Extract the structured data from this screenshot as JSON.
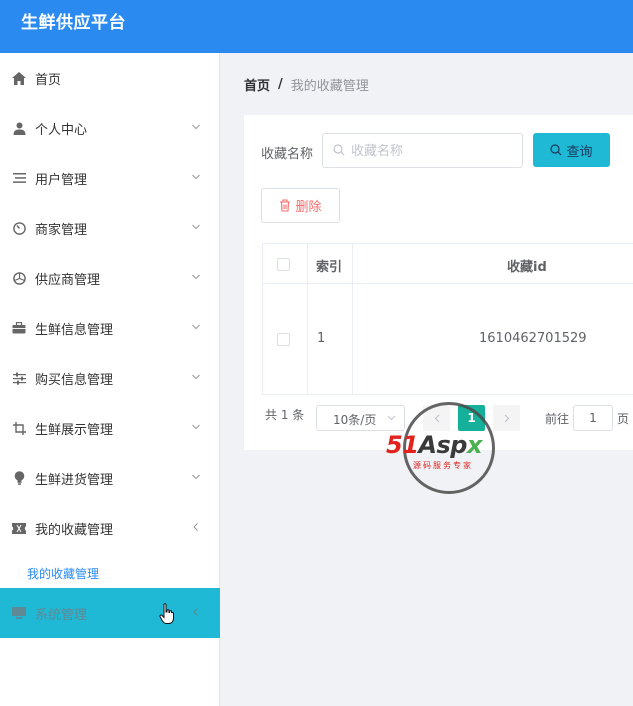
{
  "app": {
    "title": "生鲜供应平台"
  },
  "sidebar": {
    "items": [
      {
        "label": "首页",
        "icon": "home-icon"
      },
      {
        "label": "个人中心",
        "icon": "user-icon"
      },
      {
        "label": "用户管理",
        "icon": "list-icon"
      },
      {
        "label": "商家管理",
        "icon": "gauge-icon"
      },
      {
        "label": "供应商管理",
        "icon": "aperture-icon"
      },
      {
        "label": "生鲜信息管理",
        "icon": "briefcase-icon"
      },
      {
        "label": "购买信息管理",
        "icon": "sliders-icon"
      },
      {
        "label": "生鲜展示管理",
        "icon": "crop-icon"
      },
      {
        "label": "生鲜进货管理",
        "icon": "bulb-icon"
      },
      {
        "label": "我的收藏管理",
        "icon": "ticket-icon"
      },
      {
        "label": "系统管理",
        "icon": "system-icon"
      }
    ],
    "submenu": {
      "label": "我的收藏管理"
    }
  },
  "breadcrumb": {
    "home": "首页",
    "separator": "/",
    "current": "我的收藏管理"
  },
  "filter": {
    "label": "收藏名称",
    "placeholder": "收藏名称",
    "value": ""
  },
  "buttons": {
    "query": "查询",
    "delete": "删除"
  },
  "table": {
    "columns": [
      "索引",
      "收藏id"
    ],
    "rows": [
      {
        "index": "1",
        "id": "1610462701529"
      }
    ]
  },
  "pagination": {
    "total": "共 1 条",
    "page_size": "10条/页",
    "current_page": "1",
    "goto_label": "前往",
    "goto_value": "1",
    "goto_suffix": "页"
  },
  "watermark": {
    "brand_51": "51",
    "brand_asp": "Asp",
    "brand_x": "x",
    "subtitle": "源码服务专家"
  },
  "colors": {
    "header": "#2a8af0",
    "accent": "#1fb8d5",
    "page_active": "#14b09a",
    "danger": "#f56c6c"
  }
}
